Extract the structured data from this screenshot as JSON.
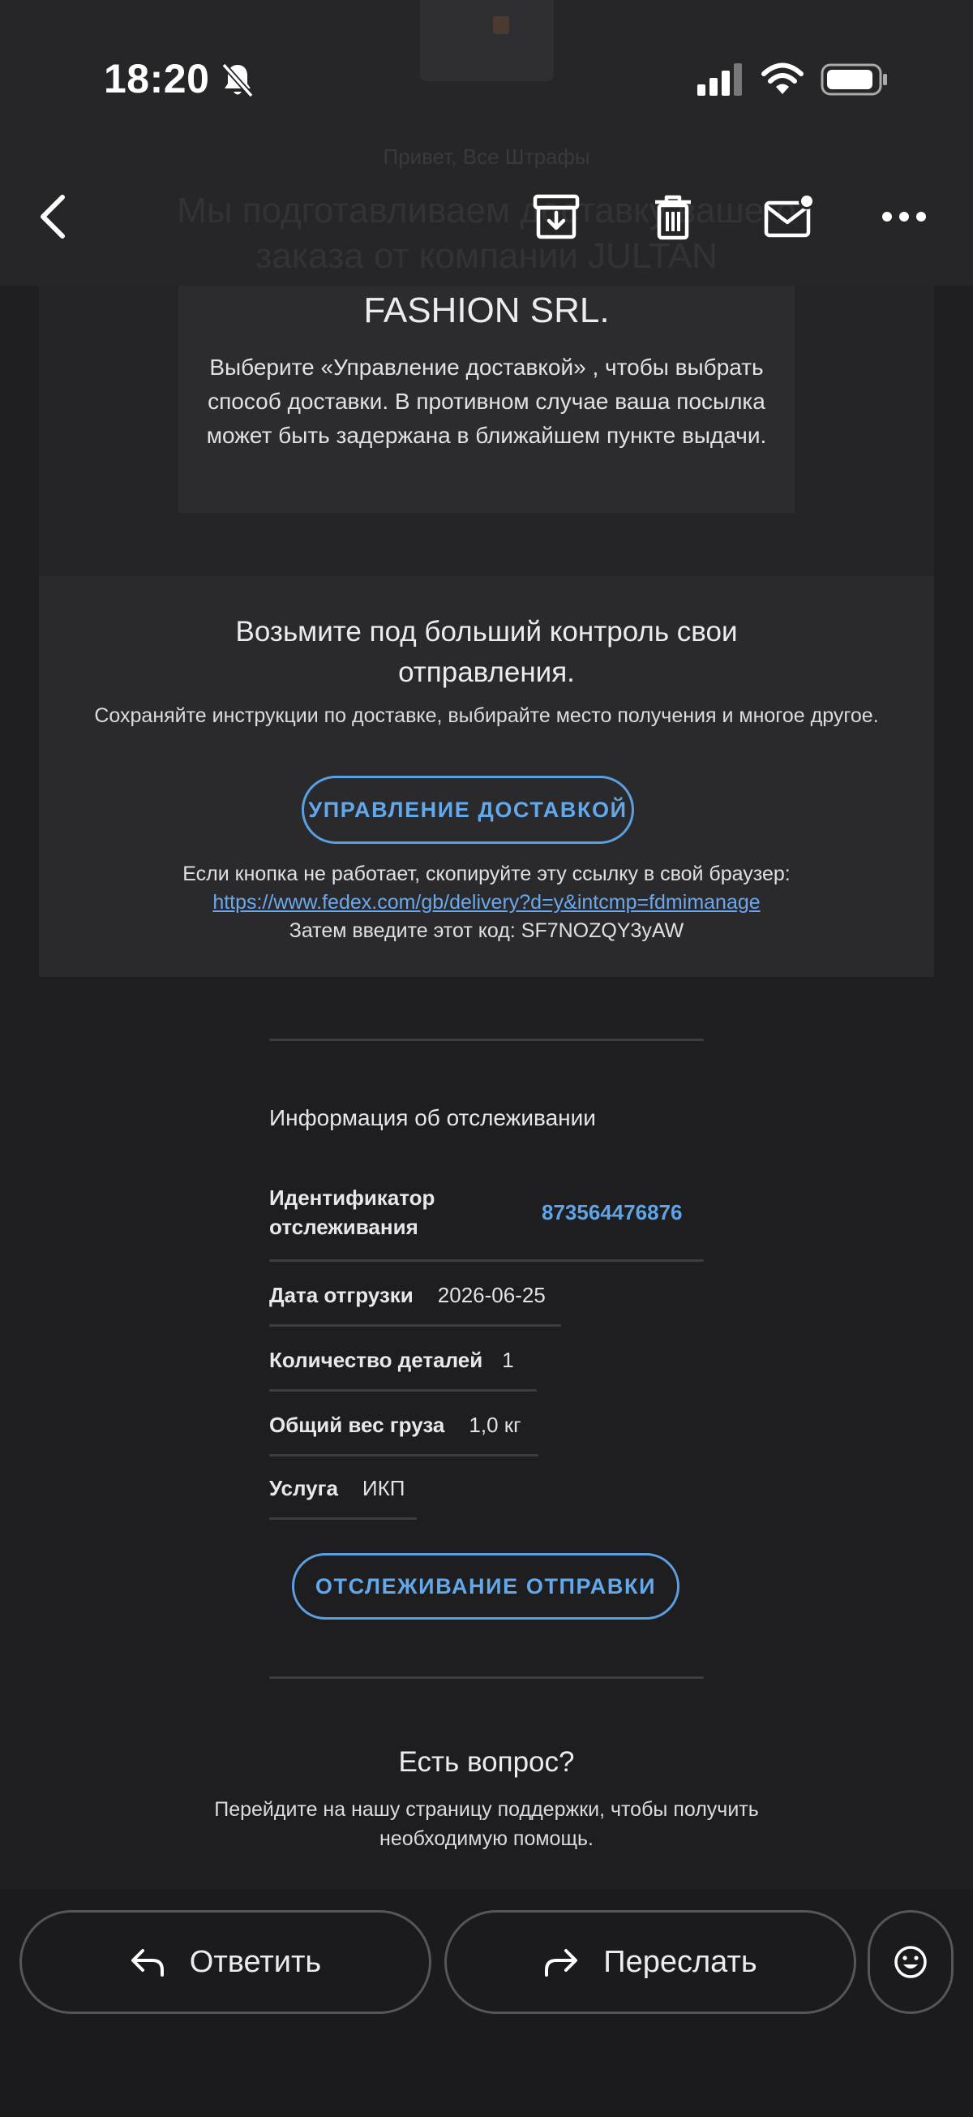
{
  "status_bar": {
    "time": "18:20",
    "icons": [
      "bell-off-icon",
      "signal-icon",
      "wifi-icon",
      "battery-icon"
    ]
  },
  "toolbar": {
    "icons": [
      "back-icon",
      "archive-icon",
      "trash-icon",
      "mark-unread-icon",
      "more-icon"
    ]
  },
  "email": {
    "behind_header_small": "Привет, Все Штрафы",
    "behind_title": "Мы подготавливаем доставку вашего заказа от компании JULTAN",
    "fashion_line": "FASHION SRL.",
    "choose_text": "Выберите «Управление доставкой» , чтобы выбрать способ доставки. В противном случае ваша посылка может быть задержана в ближайшем пункте выдачи.",
    "control_heading": "Возьмите под больший контроль свои отправления.",
    "control_sub": "Сохраняйте инструкции по доставке, выбирайте место получения и многое другое.",
    "manage_button": "УПРАВЛЕНИЕ ДОСТАВКОЙ",
    "fallback_text": "Если кнопка не работает, скопируйте эту ссылку в свой браузер:",
    "fallback_link": "https://www.fedex.com/gb/delivery?d=y&intcmp=fdmimanage",
    "code_text": "Затем введите этот код: SF7NOZQY3yAW",
    "tracking": {
      "title": "Информация об отслеживании",
      "rows": [
        {
          "label": "Идентификатор отслеживания",
          "value": "873564476876"
        },
        {
          "label": "Дата отгрузки",
          "value": "2026-06-25"
        },
        {
          "label": "Количество деталей",
          "value": "1"
        },
        {
          "label": "Общий вес груза",
          "value": "1,0 кг"
        },
        {
          "label": "Услуга",
          "value": "ИКП"
        }
      ]
    },
    "track_button": "ОТСЛЕЖИВАНИЕ ОТПРАВКИ",
    "question_heading": "Есть вопрос?",
    "question_sub": "Перейдите на нашу страницу поддержки, чтобы получить необходимую помощь."
  },
  "actions": {
    "reply": "Ответить",
    "forward": "Переслать"
  },
  "colors": {
    "accent": "#5aa0e0",
    "background": "#1e1e20",
    "header": "#262629"
  }
}
